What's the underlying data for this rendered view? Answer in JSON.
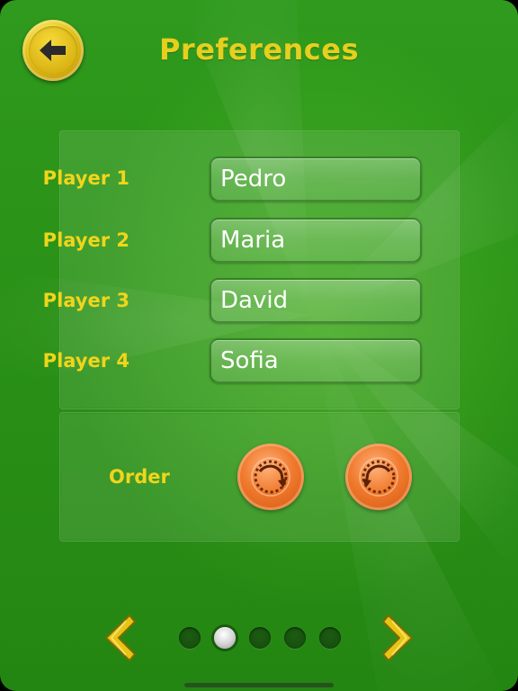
{
  "header": {
    "title": "Preferences",
    "back_icon": "arrow-left-icon"
  },
  "players": [
    {
      "label": "Player 1",
      "value": "Pedro"
    },
    {
      "label": "Player 2",
      "value": "Maria"
    },
    {
      "label": "Player 3",
      "value": "David"
    },
    {
      "label": "Player 4",
      "value": "Sofia"
    }
  ],
  "order": {
    "label": "Order",
    "options": [
      {
        "icon": "rotate-clockwise-icon",
        "selected": true
      },
      {
        "icon": "rotate-counterclockwise-icon",
        "selected": false
      }
    ]
  },
  "pagination": {
    "prev_icon": "chevron-left-icon",
    "next_icon": "chevron-right-icon",
    "page_count": 5,
    "current_page": 2
  },
  "colors": {
    "background": "#2a9217",
    "label": "#f1d51a",
    "title": "#e6cf1e",
    "accent_orange": "#f07a2e",
    "back_button": "#e6c21a"
  }
}
